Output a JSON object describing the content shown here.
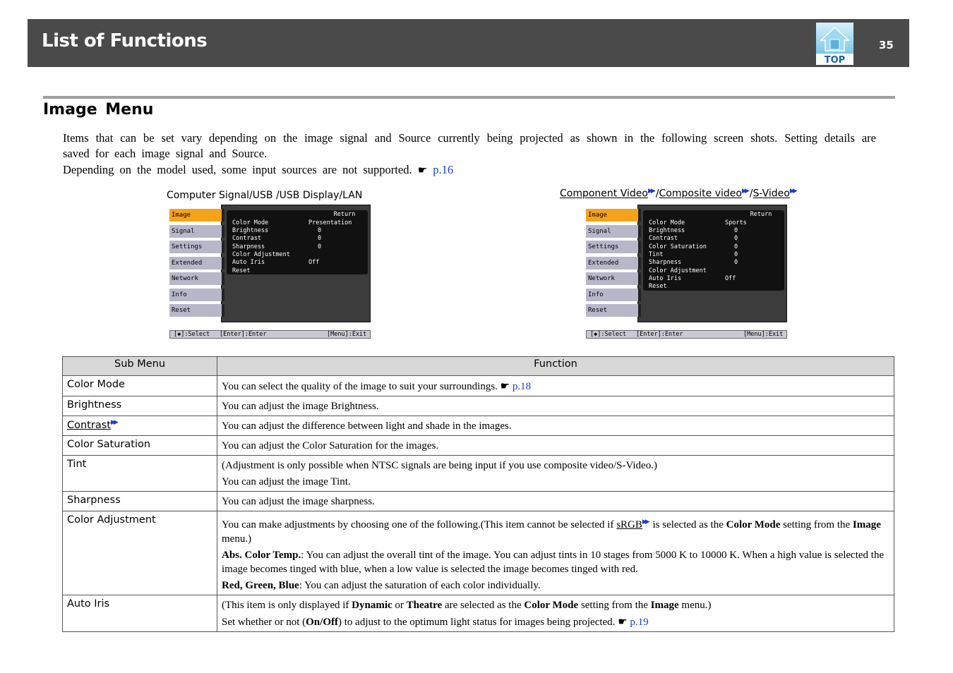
{
  "header": {
    "title": "List of Functions",
    "top_label": "TOP",
    "page_number": "35"
  },
  "section": {
    "title": "Image  Menu",
    "intro_1": "Items that can be set vary depending on the image signal and Source currently being projected as shown in the following screen shots. Setting details are saved for each image signal and Source.",
    "intro_2": "Depending on the model used, some input sources are not supported.",
    "intro_2_link": "p.16"
  },
  "screenshots": [
    {
      "caption": "Computer Signal/USB /USB Display/LAN",
      "sidebar": [
        "Image",
        "Signal",
        "Settings",
        "Extended",
        "Network",
        "Info",
        "Reset"
      ],
      "return_label": "Return",
      "rows": [
        {
          "label": "Color Mode",
          "value": "Presentation"
        },
        {
          "label": "Brightness",
          "value": "0"
        },
        {
          "label": "Contrast",
          "value": "0"
        },
        {
          "label": "Sharpness",
          "value": "0"
        },
        {
          "label": "Color Adjustment",
          "value": ""
        },
        {
          "label": "Auto Iris",
          "value": "Off"
        },
        {
          "label": "Reset",
          "value": ""
        }
      ],
      "footer": {
        "select": "[◆]:Select",
        "enter": "[Enter]:Enter",
        "exit": "[Menu]:Exit"
      }
    },
    {
      "caption_parts": [
        "Component Video",
        "Composite video",
        "S-Video"
      ],
      "sidebar": [
        "Image",
        "Signal",
        "Settings",
        "Extended",
        "Network",
        "Info",
        "Reset"
      ],
      "return_label": "Return",
      "rows": [
        {
          "label": "Color Mode",
          "value": "Sports"
        },
        {
          "label": "Brightness",
          "value": "0"
        },
        {
          "label": "Contrast",
          "value": "0"
        },
        {
          "label": "Color Saturation",
          "value": "0"
        },
        {
          "label": "Tint",
          "value": "0"
        },
        {
          "label": "Sharpness",
          "value": "0"
        },
        {
          "label": "Color Adjustment",
          "value": ""
        },
        {
          "label": "Auto Iris",
          "value": "Off"
        },
        {
          "label": "Reset",
          "value": ""
        }
      ],
      "footer": {
        "select": "[◆]:Select",
        "enter": "[Enter]:Enter",
        "exit": "[Menu]:Exit"
      }
    }
  ],
  "table": {
    "headers": [
      "Sub Menu",
      "Function"
    ],
    "rows": {
      "color_mode": {
        "name": "Color Mode",
        "text": "You can select the quality of the image to suit your surroundings.",
        "link": "p.18"
      },
      "brightness": {
        "name": "Brightness",
        "text": "You can adjust the image Brightness."
      },
      "contrast": {
        "name": "Contrast",
        "text": "You can adjust the difference between light and shade in the images."
      },
      "color_saturation": {
        "name": "Color Saturation",
        "text": "You can adjust the Color Saturation for the images."
      },
      "tint": {
        "name": "Tint",
        "text_1": "(Adjustment is only possible when NTSC signals are being input if you use composite video/S-Video.)",
        "text_2": "You can adjust the image Tint."
      },
      "sharpness": {
        "name": "Sharpness",
        "text": "You can adjust the image sharpness."
      },
      "color_adjustment": {
        "name": "Color Adjustment",
        "p1_a": "You can make adjustments by choosing one of the following.(This item cannot be selected if ",
        "p1_link": "sRGB",
        "p1_b": " is selected as the ",
        "p1_bold1": "Color Mode",
        "p1_c": " setting from the ",
        "p1_bold2": "Image",
        "p1_d": " menu.)",
        "p2_bold": "Abs. Color Temp.",
        "p2_text": ": You can adjust the overall tint of the image. You can adjust tints in 10 stages from 5000 K to 10000 K. When a high value is selected the image becomes tinged with blue, when a low value is selected the image becomes tinged with red.",
        "p3_bold": "Red, Green, Blue",
        "p3_text": ": You can adjust the saturation of each color individually."
      },
      "auto_iris": {
        "name": "Auto Iris",
        "p1_a": "(This item is only displayed if ",
        "p1_bold1": "Dynamic",
        "p1_b": " or ",
        "p1_bold2": "Theatre",
        "p1_c": " are selected as the ",
        "p1_bold3": "Color Mode",
        "p1_d": " setting from the ",
        "p1_bold4": "Image",
        "p1_e": " menu.)",
        "p2_a": "Set whether or not (",
        "p2_bold1": "On",
        "p2_slash": "/",
        "p2_bold2": "Off",
        "p2_b": ") to adjust to the optimum light status for images being projected.",
        "p2_link": "p.19"
      }
    }
  },
  "colors": {
    "header_bg": "#4a4a4a",
    "link": "#1a3dcc",
    "menu_active": "#f6a21a"
  }
}
